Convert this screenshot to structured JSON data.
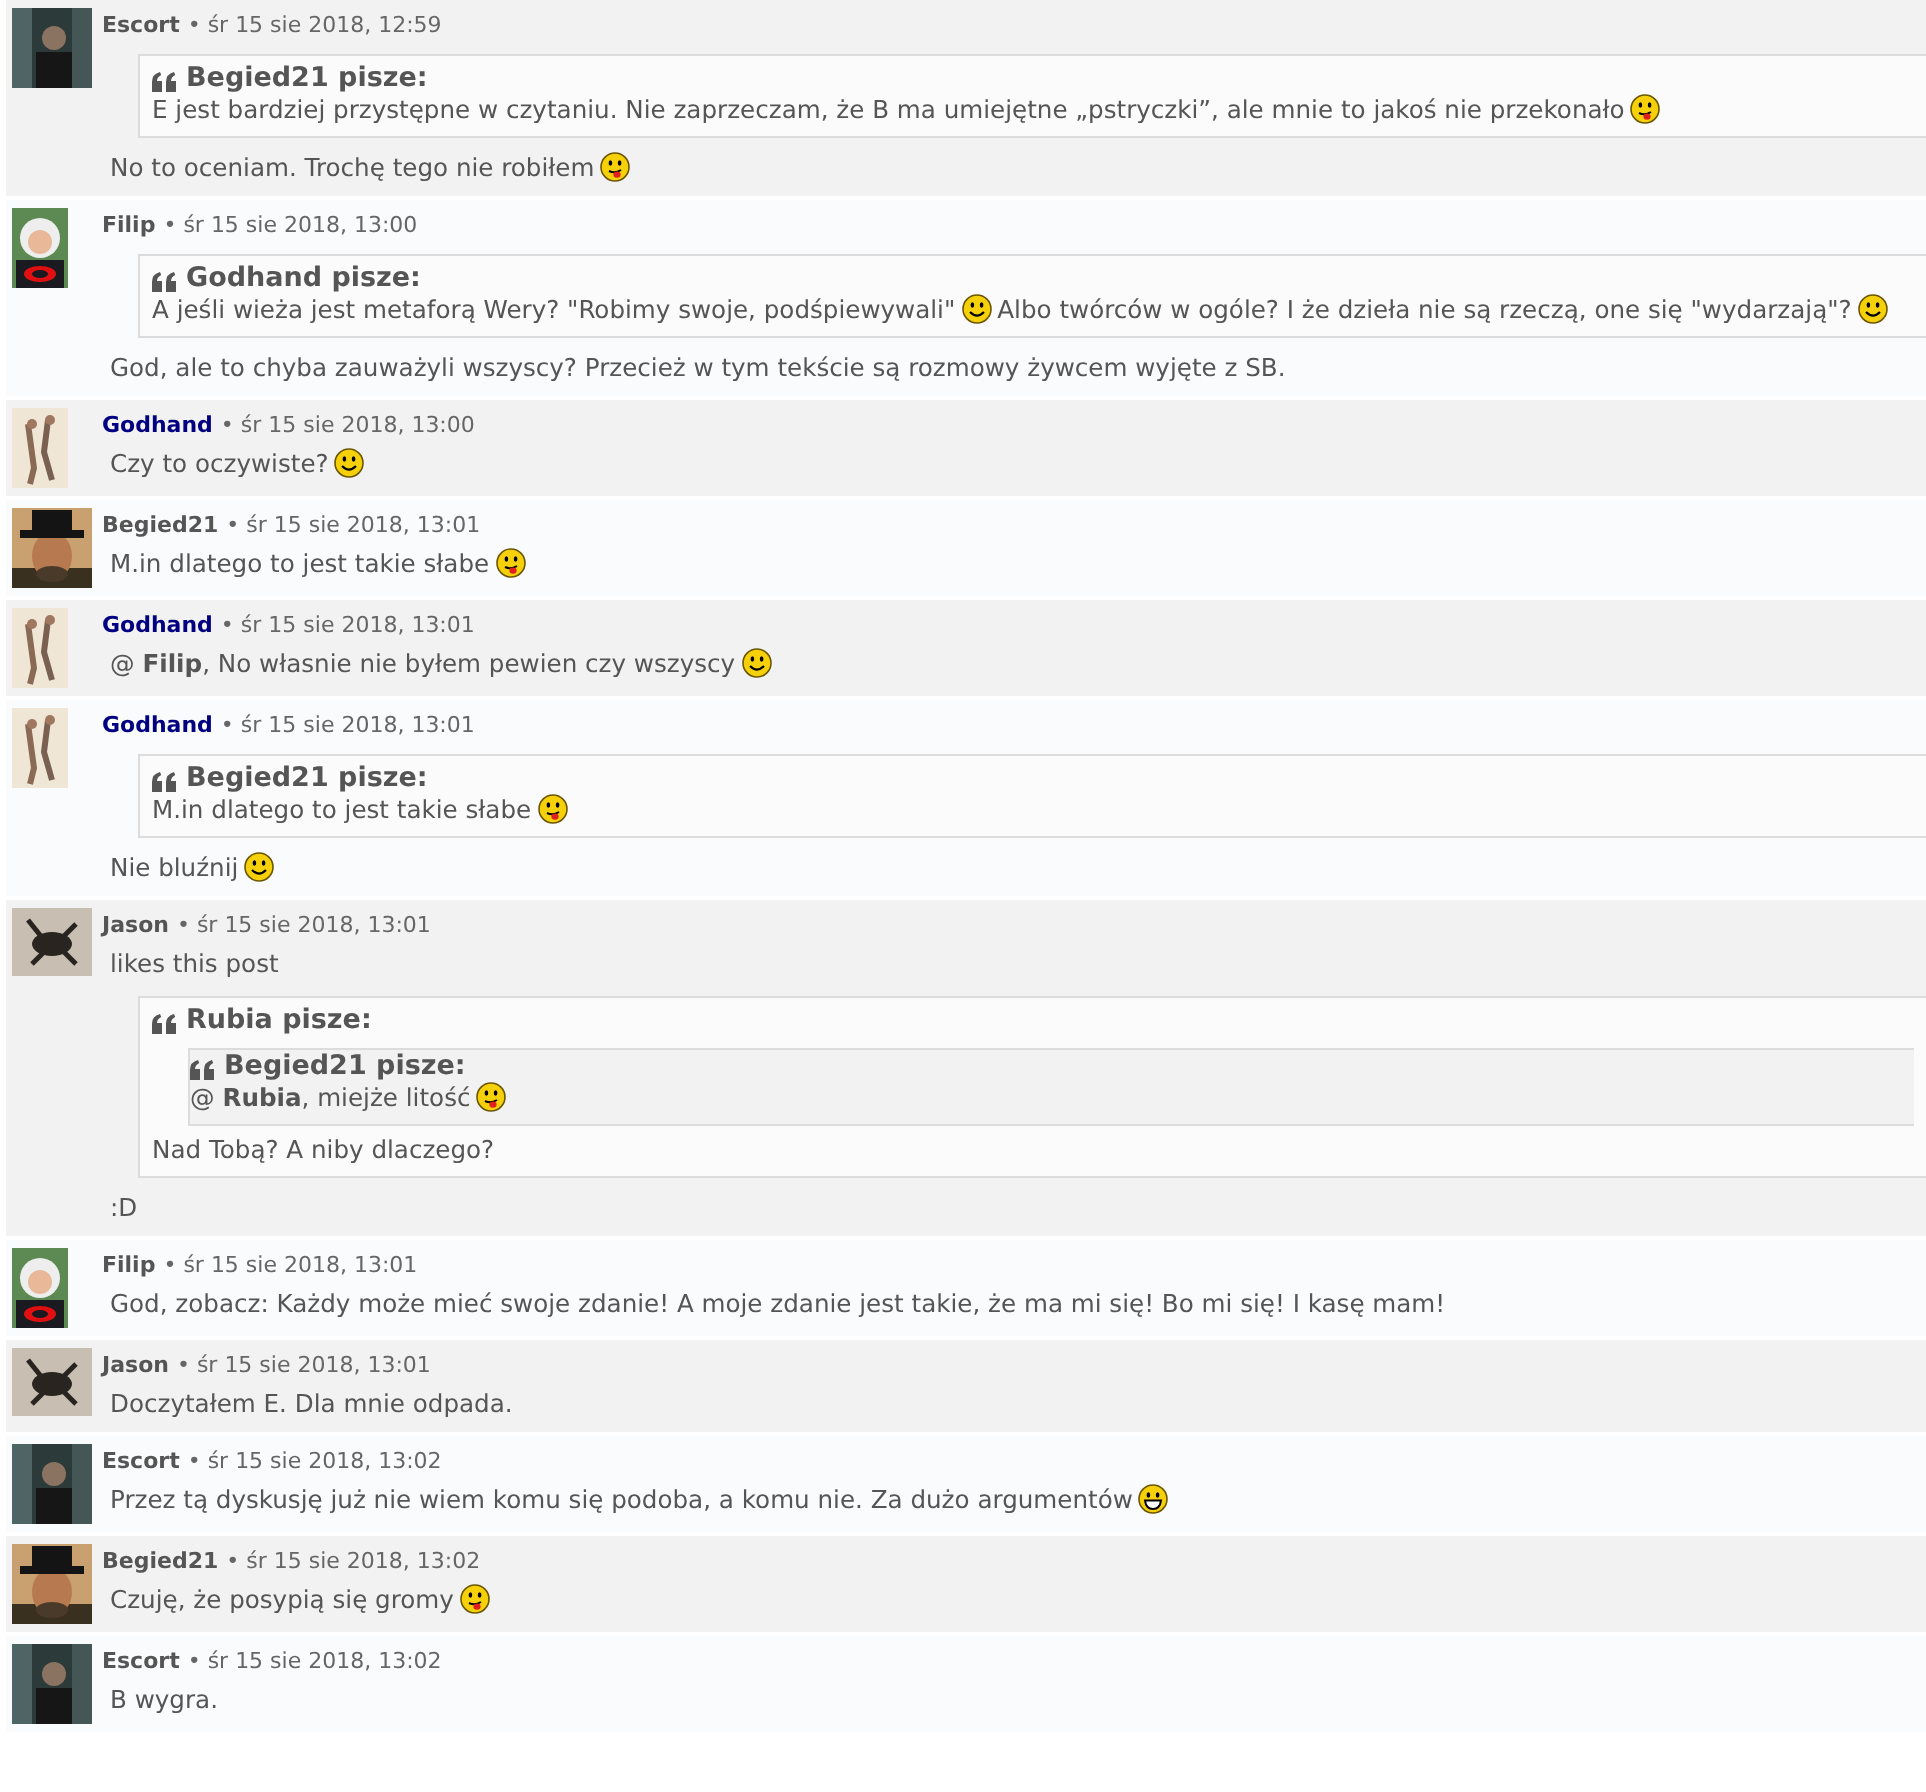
{
  "posts": [
    {
      "author": "Escort",
      "color": "#555555",
      "avatar": {
        "kind": "dark"
      },
      "meta": "• śr 15 sie 2018, 12:59",
      "blocks": [
        {
          "kind": "quote",
          "author": "Begied21 pisze:",
          "blocks": [
            {
              "kind": "text",
              "parts": [
                {
                  "kind": "text",
                  "text": "E jest bardziej przystępne w czytaniu. Nie zaprzeczam, że B ma umiejętne „pstryczki”, ale mnie to jakoś nie przekonało"
                },
                {
                  "kind": "tongue"
                }
              ]
            }
          ]
        },
        {
          "kind": "text",
          "parts": [
            {
              "kind": "text",
              "text": "No to oceniam. Trochę tego nie robiłem"
            },
            {
              "kind": "tongue"
            }
          ]
        }
      ]
    },
    {
      "author": "Filip",
      "color": "#555555",
      "avatar": {
        "kind": "child"
      },
      "meta": "• śr 15 sie 2018, 13:00",
      "blocks": [
        {
          "kind": "quote",
          "author": "Godhand pisze:",
          "blocks": [
            {
              "kind": "text",
              "parts": [
                {
                  "kind": "text",
                  "text": "A jeśli wieża jest metaforą Wery? \"Robimy swoje, podśpiewywali\""
                },
                {
                  "kind": "smile"
                },
                {
                  "kind": "text",
                  "text": "Albo twórców w ogóle? I że dzieła nie są rzeczą, one się \"wydarzają\"?"
                },
                {
                  "kind": "smile"
                }
              ]
            }
          ]
        },
        {
          "kind": "text",
          "parts": [
            {
              "kind": "text",
              "text": "God, ale to chyba zauważyli wszyscy? Przecież w tym tekście są rozmowy żywcem wyjęte z SB."
            }
          ]
        }
      ]
    },
    {
      "author": "Godhand",
      "color": "#000080",
      "avatar": {
        "kind": "sketch"
      },
      "meta": "• śr 15 sie 2018, 13:00",
      "blocks": [
        {
          "kind": "text",
          "parts": [
            {
              "kind": "text",
              "text": "Czy to oczywiste?"
            },
            {
              "kind": "smile"
            }
          ]
        }
      ]
    },
    {
      "author": "Begied21",
      "color": "#555555",
      "avatar": {
        "kind": "hat"
      },
      "meta": "• śr 15 sie 2018, 13:01",
      "blocks": [
        {
          "kind": "text",
          "parts": [
            {
              "kind": "text",
              "text": "M.in dlatego to jest takie słabe"
            },
            {
              "kind": "tongue"
            }
          ]
        }
      ]
    },
    {
      "author": "Godhand",
      "color": "#000080",
      "avatar": {
        "kind": "sketch"
      },
      "meta": "• śr 15 sie 2018, 13:01",
      "blocks": [
        {
          "kind": "text",
          "parts": [
            {
              "kind": "text",
              "text": "@ **Filip**, No własnie nie byłem pewien czy wszyscy"
            },
            {
              "kind": "smile"
            }
          ]
        }
      ]
    },
    {
      "author": "Godhand",
      "color": "#000080",
      "avatar": {
        "kind": "sketch"
      },
      "meta": "• śr 15 sie 2018, 13:01",
      "blocks": [
        {
          "kind": "quote",
          "author": "Begied21 pisze:",
          "blocks": [
            {
              "kind": "text",
              "parts": [
                {
                  "kind": "text",
                  "text": "M.in dlatego to jest takie słabe"
                },
                {
                  "kind": "tongue"
                }
              ]
            }
          ]
        },
        {
          "kind": "text",
          "parts": [
            {
              "kind": "text",
              "text": "Nie bluźnij"
            },
            {
              "kind": "smile"
            }
          ]
        }
      ]
    },
    {
      "author": "Jason",
      "color": "#555555",
      "avatar": {
        "kind": "creature"
      },
      "meta": "• śr 15 sie 2018, 13:01",
      "blocks": [
        {
          "kind": "text",
          "parts": [
            {
              "kind": "text",
              "text": "likes this post"
            }
          ]
        },
        {
          "kind": "quote",
          "author": "Rubia pisze:",
          "blocks": [
            {
              "kind": "quote",
              "author": "Begied21 pisze:",
              "blocks": [
                {
                  "kind": "text",
                  "parts": [
                    {
                      "kind": "text",
                      "text": "@ **Rubia**, miejże litość"
                    },
                    {
                      "kind": "tongue"
                    }
                  ]
                }
              ]
            },
            {
              "kind": "text",
              "parts": [
                {
                  "kind": "text",
                  "text": "Nad Tobą? A niby dlaczego?"
                }
              ]
            }
          ]
        },
        {
          "kind": "text",
          "parts": [
            {
              "kind": "text",
              "text": ":D"
            }
          ]
        }
      ]
    },
    {
      "author": "Filip",
      "color": "#555555",
      "avatar": {
        "kind": "child"
      },
      "meta": "• śr 15 sie 2018, 13:01",
      "blocks": [
        {
          "kind": "text",
          "parts": [
            {
              "kind": "text",
              "text": "God, zobacz: Każdy może mieć swoje zdanie! A moje zdanie jest takie, że ma mi się! Bo mi się! I kasę mam!"
            }
          ]
        }
      ]
    },
    {
      "author": "Jason",
      "color": "#555555",
      "avatar": {
        "kind": "creature"
      },
      "meta": "• śr 15 sie 2018, 13:01",
      "blocks": [
        {
          "kind": "text",
          "parts": [
            {
              "kind": "text",
              "text": "Doczytałem E. Dla mnie odpada."
            }
          ]
        }
      ]
    },
    {
      "author": "Escort",
      "color": "#555555",
      "avatar": {
        "kind": "dark"
      },
      "meta": "• śr 15 sie 2018, 13:02",
      "blocks": [
        {
          "kind": "text",
          "parts": [
            {
              "kind": "text",
              "text": "Przez tą dyskusję już nie wiem komu się podoba, a komu nie. Za dużo argumentów"
            },
            {
              "kind": "grin"
            }
          ]
        }
      ]
    },
    {
      "author": "Begied21",
      "color": "#555555",
      "avatar": {
        "kind": "hat"
      },
      "meta": "• śr 15 sie 2018, 13:02",
      "blocks": [
        {
          "kind": "text",
          "parts": [
            {
              "kind": "text",
              "text": "Czuję, że posypią się gromy"
            },
            {
              "kind": "tongue"
            }
          ]
        }
      ]
    },
    {
      "author": "Escort",
      "color": "#555555",
      "avatar": {
        "kind": "dark"
      },
      "meta": "• śr 15 sie 2018, 13:02",
      "blocks": [
        {
          "kind": "text",
          "parts": [
            {
              "kind": "text",
              "text": "B wygra."
            }
          ]
        }
      ]
    }
  ]
}
